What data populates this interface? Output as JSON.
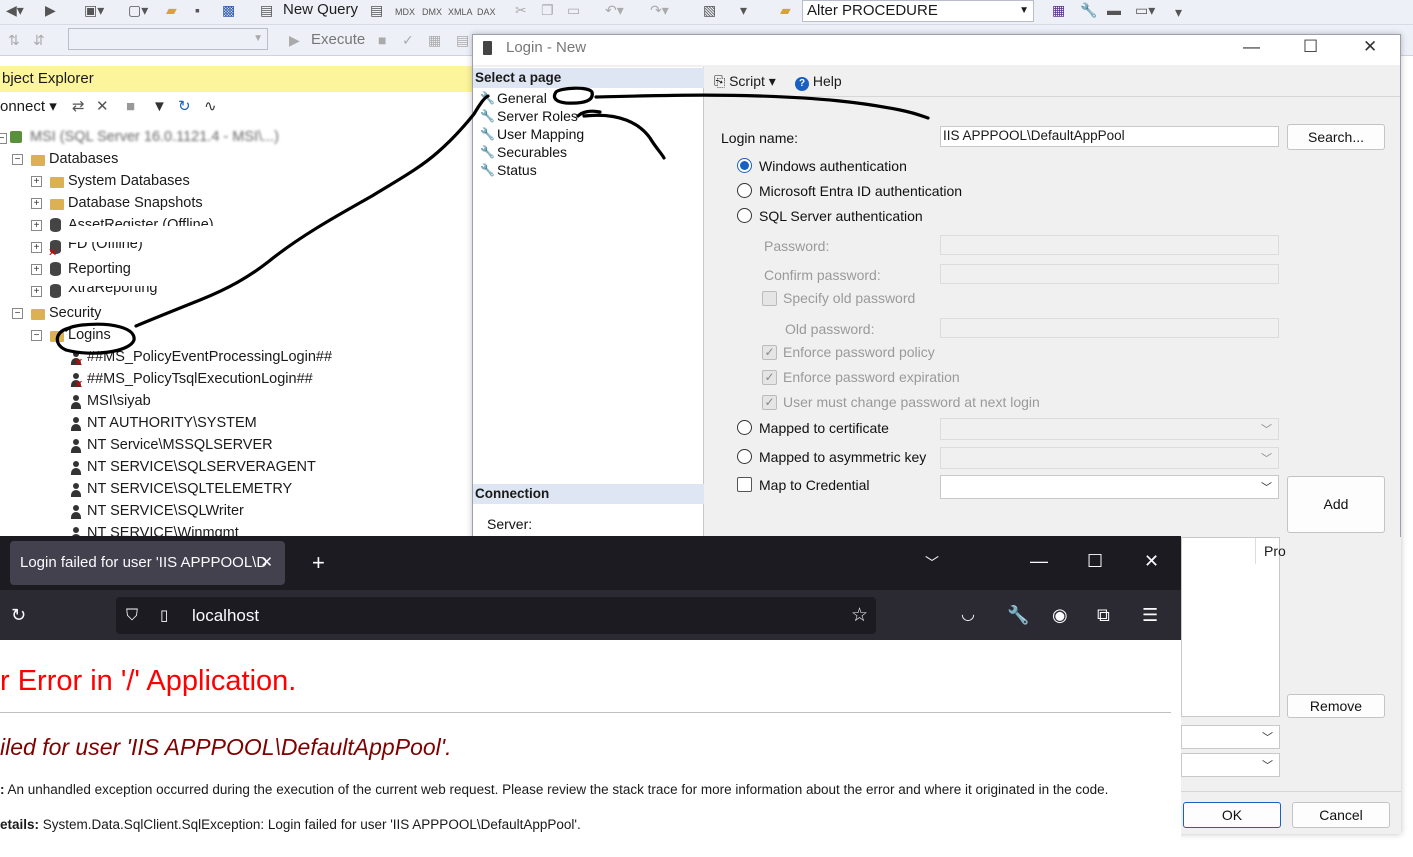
{
  "toolbar": {
    "new_query": "New Query",
    "mdx": "MDX",
    "dmx": "DMX",
    "xmla": "XMLA",
    "dax": "DAX",
    "alter_combo": "Alter   PROCEDURE",
    "execute": "Execute"
  },
  "object_explorer": {
    "title": "bject Explorer",
    "connect": "onnect",
    "server": "MSI (SQL Server 16.0.1121.4 - MSI\\...)",
    "nodes": {
      "databases": "Databases",
      "system_databases": "System Databases",
      "database_snapshots": "Database Snapshots",
      "asset_register": "AssetRegister (Offline)",
      "fd_offline": "FD (Offline)",
      "reporting": "Reporting",
      "xtra_reporting": "XtraReporting",
      "security": "Security",
      "logins": "Logins"
    },
    "logins": [
      "##MS_PolicyEventProcessingLogin##",
      "##MS_PolicyTsqlExecutionLogin##",
      "MSI\\siyab",
      "NT AUTHORITY\\SYSTEM",
      "NT Service\\MSSQLSERVER",
      "NT SERVICE\\SQLSERVERAGENT",
      "NT SERVICE\\SQLTELEMETRY",
      "NT SERVICE\\SQLWriter",
      "NT SERVICE\\Winmgmt"
    ]
  },
  "login_dialog": {
    "title": "Login - New",
    "select_page": "Select a page",
    "pages": [
      "General",
      "Server Roles",
      "User Mapping",
      "Securables",
      "Status"
    ],
    "connection": "Connection",
    "server_label": "Server:",
    "script": "Script",
    "help": "Help",
    "login_name_label": "Login name:",
    "login_name_value": "IIS APPPOOL\\DefaultAppPool",
    "search_button": "Search...",
    "auth": {
      "windows": "Windows authentication",
      "entra": "Microsoft Entra ID authentication",
      "sql": "SQL Server authentication"
    },
    "password": "Password:",
    "confirm_password": "Confirm password:",
    "specify_old": "Specify old password",
    "old_password": "Old password:",
    "enforce_policy": "Enforce password policy",
    "enforce_expiration": "Enforce password expiration",
    "must_change": "User must change password at next login",
    "mapped_cert": "Mapped to certificate",
    "mapped_key": "Mapped to asymmetric key",
    "map_credential": "Map to Credential",
    "add": "Add",
    "provider_header": "Pro",
    "remove": "Remove",
    "ok": "OK",
    "cancel": "Cancel"
  },
  "browser": {
    "tab_title": "Login failed for user 'IIS APPPOOL\\D",
    "url": "localhost",
    "error_title": "r Error in '/' Application.",
    "error_subtitle": "iled for user 'IIS APPPOOL\\DefaultAppPool'.",
    "desc_label": ":",
    "desc_text": " An unhandled exception occurred during the execution of the current web request. Please review the stack trace for more information about the error and where it originated in the code.",
    "details_label": "etails:",
    "details_text": " System.Data.SqlClient.SqlException: Login failed for user 'IIS APPPOOL\\DefaultAppPool'."
  },
  "colors": {
    "oe_title_bg": "#fdf59c",
    "error_red": "#ff0000",
    "error_maroon": "#800000",
    "radio_blue": "#1a5fc2",
    "browser_dark": "#1c1b22"
  }
}
